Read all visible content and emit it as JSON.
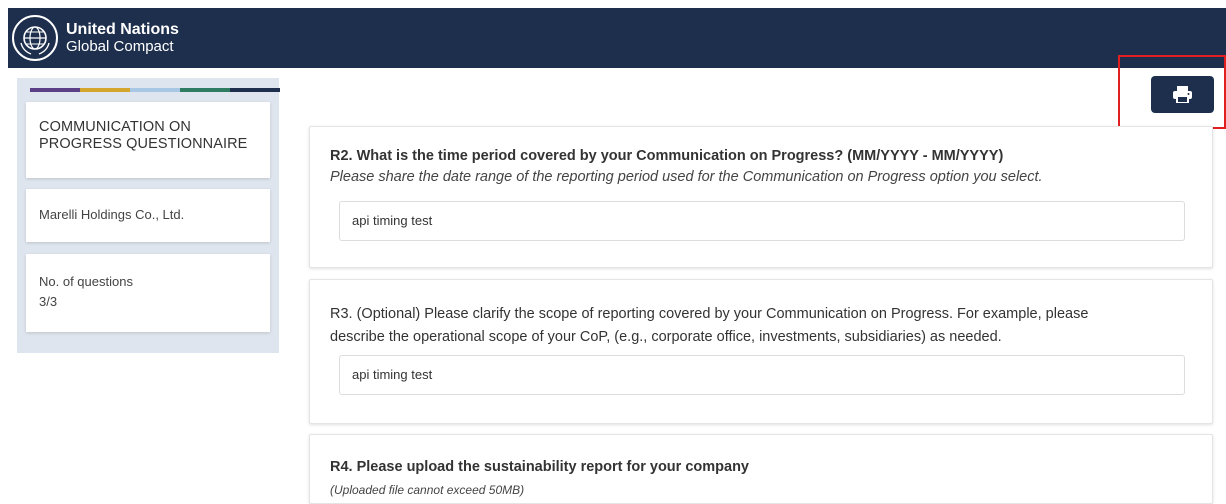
{
  "header": {
    "brand_line1": "United Nations",
    "brand_line2": "Global Compact",
    "logo_icon": "un-global-compact-logo-icon",
    "background": "#1e2f4e"
  },
  "sidebar": {
    "stripe_colors": [
      "#5b3f86",
      "#d4a72c",
      "#a8c7e4",
      "#2e7d63",
      "#1e2f4e"
    ],
    "title": "COMMUNICATION ON PROGRESS QUESTIONNAIRE",
    "company": "Marelli Holdings Co., Ltd.",
    "questions_label": "No. of questions",
    "questions_count": "3/3"
  },
  "toolbar": {
    "print_icon": "printer-icon"
  },
  "questions": [
    {
      "title": "R2. What is the time period covered by your Communication on Progress? (MM/YYYY - MM/YYYY)",
      "hint": "Please share the date range of the reporting period used for the Communication on Progress option you select.",
      "answer": "api timing test"
    },
    {
      "title_line1": "R3. (Optional) Please clarify the scope of reporting covered by your Communication on Progress. For example, please",
      "title_line2": "describe the operational scope of your CoP, (e.g., corporate office, investments, subsidiaries) as needed.",
      "answer": "api timing test"
    },
    {
      "title": "R4. Please upload the sustainability report for your company",
      "hint": "(Uploaded file cannot exceed 50MB)"
    }
  ]
}
